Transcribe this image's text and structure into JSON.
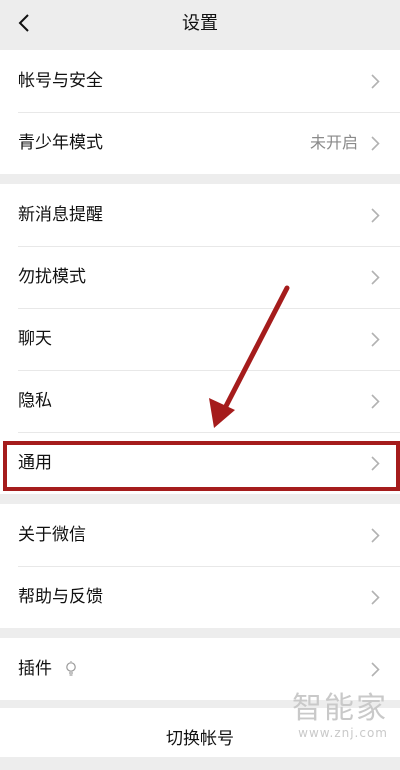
{
  "header": {
    "title": "设置"
  },
  "groups": [
    {
      "items": [
        {
          "label": "帐号与安全"
        },
        {
          "label": "青少年模式",
          "value": "未开启"
        }
      ]
    },
    {
      "items": [
        {
          "label": "新消息提醒"
        },
        {
          "label": "勿扰模式"
        },
        {
          "label": "聊天"
        },
        {
          "label": "隐私"
        },
        {
          "label": "通用"
        }
      ]
    },
    {
      "items": [
        {
          "label": "关于微信"
        },
        {
          "label": "帮助与反馈"
        }
      ]
    },
    {
      "items": [
        {
          "label": "插件",
          "icon": "lightbulb-icon"
        }
      ]
    }
  ],
  "bottom": {
    "switch_account": "切换帐号"
  },
  "watermark": {
    "main": "智能家",
    "sub": "www.znj.com"
  },
  "colors": {
    "background": "#ededed",
    "highlight": "#a51c1c"
  }
}
